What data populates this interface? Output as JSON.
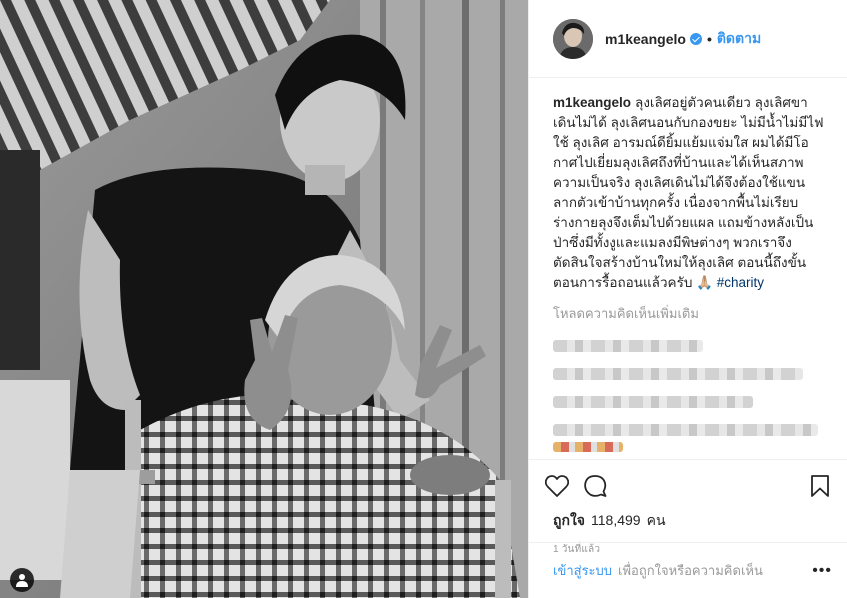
{
  "post": {
    "username": "m1keangelo",
    "follow_label": "ติดตาม",
    "separator": "•",
    "caption_username": "m1keangelo",
    "caption_text": "ลุงเลิศอยู่ตัวคนเดียว ลุงเลิศขาเดินไม่ได้ ลุงเลิศนอนกับกองขยะ ไม่มีน้ำไม่มีไฟใช้ ลุงเลิศ อารมณ์ดียิ้มแย้มแจ่มใส ผมได้มีโอกาศไปเยี่ยมลุงเลิศถึงที่บ้านและได้เห็นสภาพความเป็นจริง ลุงเลิศเดินไม่ได้จึงต้องใช้แขนลากตัวเข้าบ้านทุกครั้ง เนื่องจากพื้นไม่เรียบร่างกายลุงจึงเต็มไปด้วยแผล แถมข้างหลังเป็นป่าซึ่งมีทั้งงูและแมลงมีพิษต่างๆ พวกเราจึงตัดสินใจสร้างบ้านใหม่ให้ลุงเลิศ ตอนนี้ถึงขั้นตอนการรื้อถอนแล้วครับ 🙏🏼",
    "hashtag": "#charity",
    "load_more": "โหลดความคิดเห็นเพิ่มเติม",
    "likes_label": "ถูกใจ",
    "likes_count": "118,499",
    "likes_unit": "คน",
    "time_ago": "1 วันที่แล้ว"
  },
  "footer": {
    "login_label": "เข้าสู่ระบบ",
    "login_hint": "เพื่อถูกใจหรือความคิดเห็น",
    "more": "•••"
  },
  "icons": {
    "verified": "verified-badge-icon",
    "like": "heart-icon",
    "comment": "comment-icon",
    "save": "bookmark-icon",
    "tag": "user-tag-icon",
    "options": "more-options-icon"
  },
  "colors": {
    "accent": "#3897f0",
    "text": "#262626",
    "muted": "#999999",
    "border": "#efefef"
  }
}
